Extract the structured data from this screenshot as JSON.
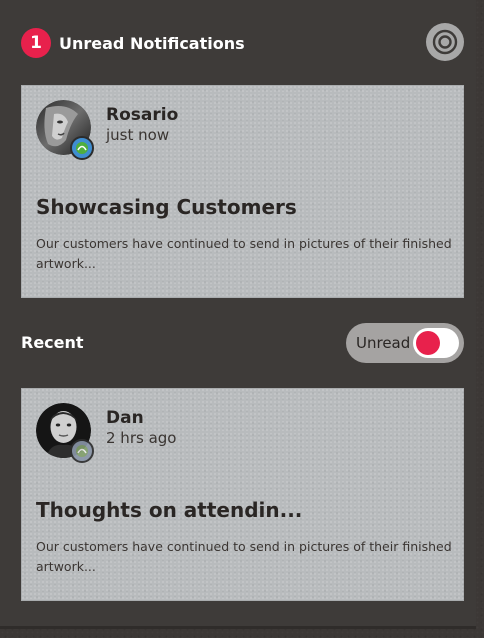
{
  "header": {
    "unread_count": "1",
    "title": "Unread Notifications",
    "settings_icon": "target-settings-icon"
  },
  "notifications": [
    {
      "author": "Rosario",
      "time": "just now",
      "title": "Showcasing Customers",
      "body": "Our customers have continued to send in pictures of their finished artwork..."
    },
    {
      "author": "Dan",
      "time": "2 hrs ago",
      "title": "Thoughts on attendin...",
      "body": "Our customers have continued to send in pictures of their finished artwork..."
    }
  ],
  "recent": {
    "label": "Recent",
    "toggle_label": "Unread",
    "toggle_on": true
  },
  "colors": {
    "accent": "#e8214c",
    "background": "#3e3b39",
    "card": "#b8bbbd"
  }
}
